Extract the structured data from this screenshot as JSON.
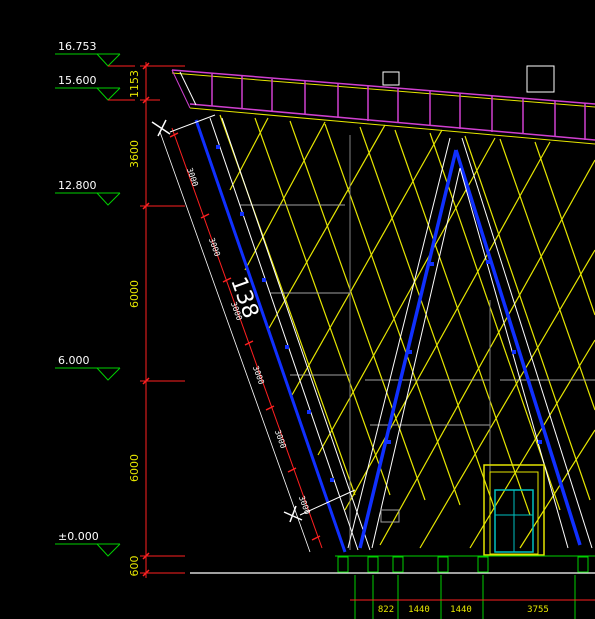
{
  "elevations": {
    "e1": "16.753",
    "e2": "15.600",
    "e3": "12.800",
    "e4": "6.000",
    "e5": "±0.000"
  },
  "vertical_dims": {
    "d1": "1153",
    "d2": "3600",
    "d3": "6000",
    "d4": "6000",
    "d5": "600"
  },
  "slope_dims": {
    "s1": "3000",
    "s2": "3000",
    "s3": "3000",
    "s4": "3000",
    "s5": "3000",
    "s6": "3000"
  },
  "slope_total": "138",
  "bottom_dims": {
    "b1": "822",
    "b2": "1440",
    "b3": "1440",
    "b4": "3755"
  },
  "colors": {
    "background": "#000000",
    "dimension_red": "#ff2020",
    "structure_blue": "#1030ff",
    "lattice_yellow": "#e6e600",
    "roof_magenta": "#d040d0",
    "level_green": "#00d000",
    "line_white": "#ffffff",
    "door_cyan": "#00c0c0"
  }
}
